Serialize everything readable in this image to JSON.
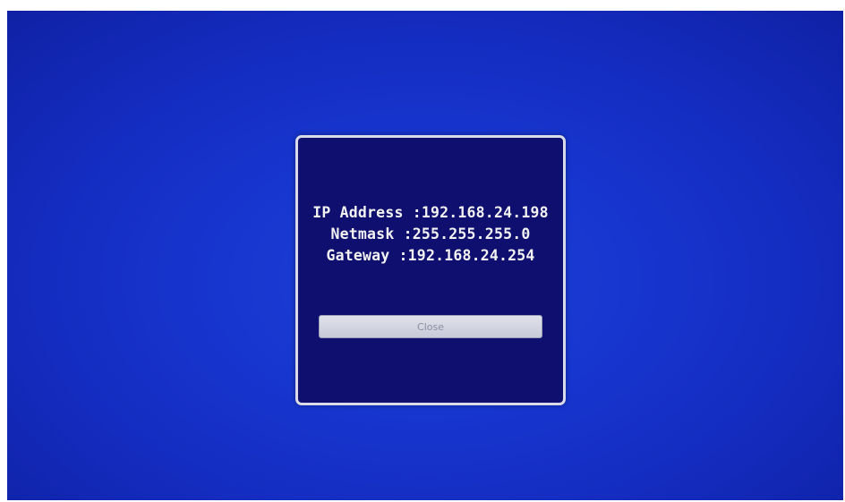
{
  "network_dialog": {
    "rows": [
      {
        "label": "IP Address",
        "value": "192.168.24.198"
      },
      {
        "label": "Netmask",
        "value": "255.255.255.0"
      },
      {
        "label": "Gateway",
        "value": "192.168.24.254"
      }
    ],
    "close_label": "Close"
  },
  "colors": {
    "screen_background": "#1736cf",
    "dialog_background": "#0f0f6f",
    "dialog_border": "#d9dbe8",
    "text": "#f2f2f2",
    "button_background": "#d4d7e2",
    "button_text": "#8a8fa3"
  }
}
